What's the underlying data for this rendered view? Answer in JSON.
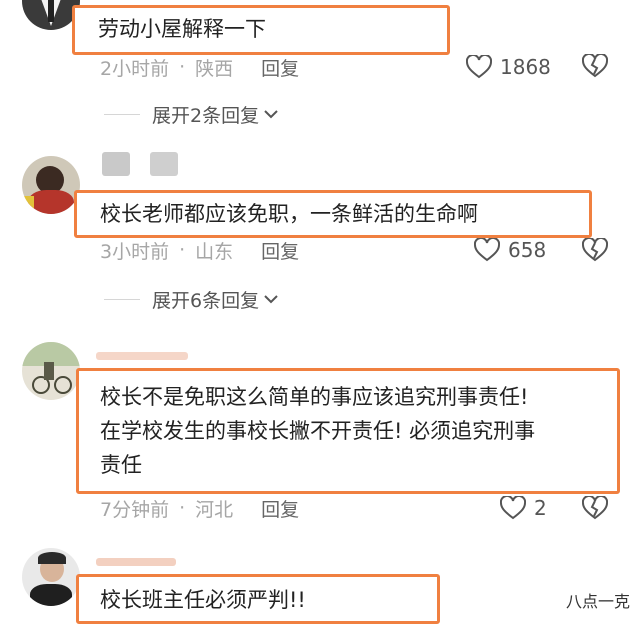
{
  "comments": [
    {
      "text": "劳动小屋解释一下",
      "time": "2小时前",
      "location": "陕西",
      "reply_label": "回复",
      "likes": "1868",
      "expand_label": "展开2条回复"
    },
    {
      "text": "校长老师都应该免职，一条鲜活的生命啊",
      "time": "3小时前",
      "location": "山东",
      "reply_label": "回复",
      "likes": "658",
      "expand_label": "展开6条回复"
    },
    {
      "text": "校长不是免职这么简单的事应该追究刑事责任!\n在学校发生的事校长撇不开责任! 必须追究刑事\n责任",
      "time": "7分钟前",
      "location": "河北",
      "reply_label": "回复",
      "likes": "2"
    },
    {
      "text": "校长班主任必须严判!!"
    }
  ],
  "watermark": "八点一克",
  "colors": {
    "highlight_border": "#f08040",
    "meta_gray": "#a6a6a6"
  }
}
